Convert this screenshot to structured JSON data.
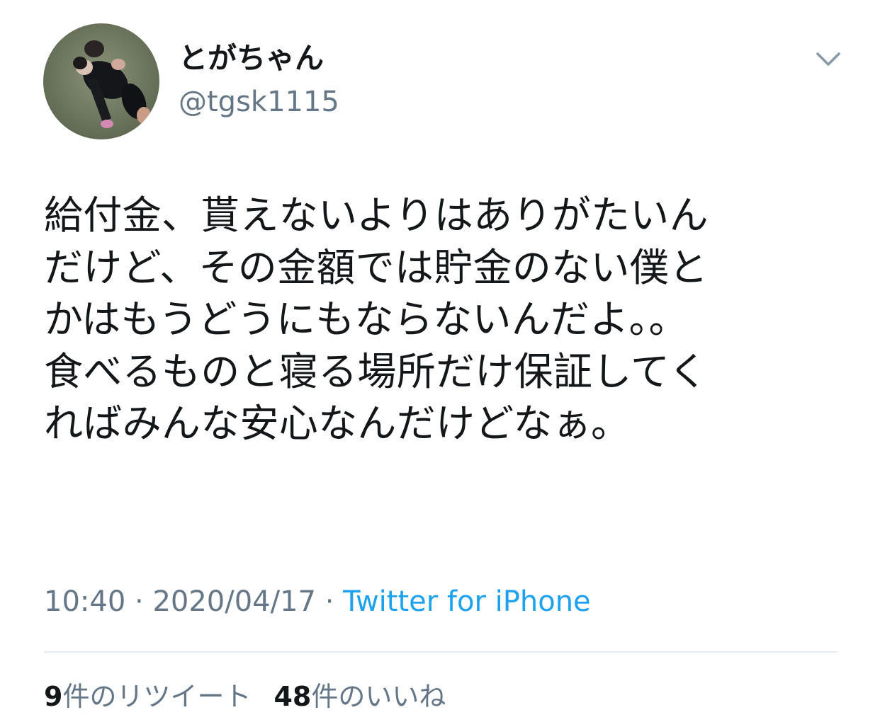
{
  "user": {
    "display_name": "とがちゃん",
    "handle": "@tgsk1115"
  },
  "icons": {
    "avatar": "user-avatar-photo",
    "menu": "chevron-down-icon"
  },
  "tweet": {
    "lines": [
      "給付金、貰えないよりはありがたいん",
      "だけど、その金額では貯金のない僕と",
      "かはもうどうにもならないんだよ。。",
      "食べるものと寝る場所だけ保証してく",
      "ればみんな安心なんだけどなぁ。"
    ],
    "time": "10:40",
    "separator": "·",
    "date": "2020/04/17",
    "source": "Twitter for iPhone"
  },
  "stats": {
    "retweets_count": "9",
    "retweets_label": "件のリツイート",
    "likes_count": "48",
    "likes_label": "件のいいね"
  },
  "colors": {
    "text": "#14171a",
    "secondary": "#657786",
    "link": "#1da1f2",
    "divider": "#e6ecf0"
  }
}
